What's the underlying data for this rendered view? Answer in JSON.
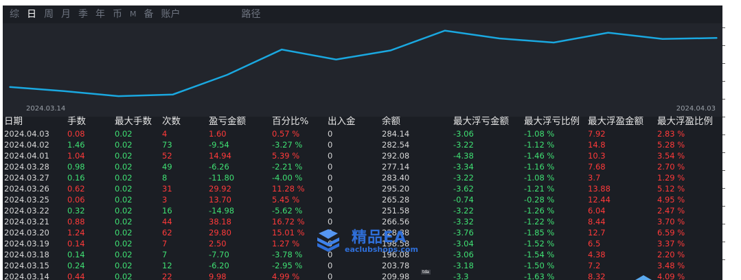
{
  "tabs": [
    {
      "label": "综",
      "active": false,
      "small": false
    },
    {
      "label": "日",
      "active": true,
      "small": false
    },
    {
      "label": "周",
      "active": false,
      "small": false
    },
    {
      "label": "月",
      "active": false,
      "small": false
    },
    {
      "label": "季",
      "active": false,
      "small": false
    },
    {
      "label": "年",
      "active": false,
      "small": false
    },
    {
      "label": "币",
      "active": false,
      "small": false
    },
    {
      "label": "M",
      "active": false,
      "small": true
    },
    {
      "label": "备",
      "active": false,
      "small": false
    },
    {
      "label": "账户",
      "active": false,
      "small": false
    }
  ],
  "path_tab": "路径",
  "chart_data": {
    "type": "line",
    "x_start_label": "2024.03.14",
    "x_end_label": "2024.04.03",
    "line_color": "#1aa8e0",
    "x": [
      "2024.03.14",
      "2024.03.15",
      "2024.03.18",
      "2024.03.19",
      "2024.03.20",
      "2024.03.21",
      "2024.03.22",
      "2024.03.25",
      "2024.03.26",
      "2024.03.27",
      "2024.03.28",
      "2024.04.01",
      "2024.04.02",
      "2024.04.03"
    ],
    "values": [
      209.98,
      203.78,
      196.08,
      198.58,
      228.38,
      266.56,
      251.58,
      265.28,
      295.2,
      283.4,
      277.14,
      292.08,
      282.54,
      284.14
    ],
    "ylim": [
      190,
      300
    ]
  },
  "table": {
    "headers": [
      "日期",
      "手数",
      "最大手数",
      "次数",
      "盈亏金额",
      "百分比%",
      "出入金",
      "余额",
      "最大浮亏金额",
      "最大浮亏比例",
      "最大浮盈金额",
      "最大浮盈比例"
    ],
    "colors": {
      "profit": "#ff3a3a",
      "loss": "#3fe073",
      "neutral": "#d7d7d7"
    },
    "rows": [
      {
        "date": "2024.04.03",
        "lots": "0.08",
        "max_lots": "0.02",
        "count": "4",
        "pnl": "1.60",
        "pct": "0.57 %",
        "io": "0",
        "balance": "284.14",
        "max_loss": "-3.06",
        "max_loss_pct": "-1.08 %",
        "max_profit": "7.92",
        "max_profit_pct": "2.83 %",
        "sign": "profit"
      },
      {
        "date": "2024.04.02",
        "lots": "1.46",
        "max_lots": "0.02",
        "count": "73",
        "pnl": "-9.54",
        "pct": "-3.27 %",
        "io": "0",
        "balance": "282.54",
        "max_loss": "-3.22",
        "max_loss_pct": "-1.12 %",
        "max_profit": "14.8",
        "max_profit_pct": "5.28 %",
        "sign": "loss"
      },
      {
        "date": "2024.04.01",
        "lots": "1.04",
        "max_lots": "0.02",
        "count": "52",
        "pnl": "14.94",
        "pct": "5.39 %",
        "io": "0",
        "balance": "292.08",
        "max_loss": "-4.38",
        "max_loss_pct": "-1.46 %",
        "max_profit": "10.3",
        "max_profit_pct": "3.54 %",
        "sign": "profit"
      },
      {
        "date": "2024.03.28",
        "lots": "0.98",
        "max_lots": "0.02",
        "count": "49",
        "pnl": "-6.26",
        "pct": "-2.21 %",
        "io": "0",
        "balance": "277.14",
        "max_loss": "-3.34",
        "max_loss_pct": "-1.16 %",
        "max_profit": "7.68",
        "max_profit_pct": "2.70 %",
        "sign": "loss"
      },
      {
        "date": "2024.03.27",
        "lots": "0.16",
        "max_lots": "0.02",
        "count": "8",
        "pnl": "-11.80",
        "pct": "-4.00 %",
        "io": "0",
        "balance": "283.40",
        "max_loss": "-3.22",
        "max_loss_pct": "-1.08 %",
        "max_profit": "3.7",
        "max_profit_pct": "1.29 %",
        "sign": "loss"
      },
      {
        "date": "2024.03.26",
        "lots": "0.62",
        "max_lots": "0.02",
        "count": "31",
        "pnl": "29.92",
        "pct": "11.28 %",
        "io": "0",
        "balance": "295.20",
        "max_loss": "-3.62",
        "max_loss_pct": "-1.21 %",
        "max_profit": "13.88",
        "max_profit_pct": "5.12 %",
        "sign": "profit"
      },
      {
        "date": "2024.03.25",
        "lots": "0.06",
        "max_lots": "0.02",
        "count": "3",
        "pnl": "13.70",
        "pct": "5.45 %",
        "io": "0",
        "balance": "265.28",
        "max_loss": "-0.74",
        "max_loss_pct": "-0.28 %",
        "max_profit": "12.44",
        "max_profit_pct": "4.95 %",
        "sign": "profit"
      },
      {
        "date": "2024.03.22",
        "lots": "0.32",
        "max_lots": "0.02",
        "count": "16",
        "pnl": "-14.98",
        "pct": "-5.62 %",
        "io": "0",
        "balance": "251.58",
        "max_loss": "-3.22",
        "max_loss_pct": "-1.26 %",
        "max_profit": "6.04",
        "max_profit_pct": "2.47 %",
        "sign": "loss"
      },
      {
        "date": "2024.03.21",
        "lots": "0.88",
        "max_lots": "0.02",
        "count": "44",
        "pnl": "38.18",
        "pct": "16.72 %",
        "io": "0",
        "balance": "266.56",
        "max_loss": "-3.32",
        "max_loss_pct": "-1.22 %",
        "max_profit": "8.44",
        "max_profit_pct": "3.70 %",
        "sign": "profit"
      },
      {
        "date": "2024.03.20",
        "lots": "1.24",
        "max_lots": "0.02",
        "count": "62",
        "pnl": "29.80",
        "pct": "15.01 %",
        "io": "0",
        "balance": "228.38",
        "max_loss": "-3.76",
        "max_loss_pct": "-1.85 %",
        "max_profit": "12.7",
        "max_profit_pct": "6.59 %",
        "sign": "profit"
      },
      {
        "date": "2024.03.19",
        "lots": "0.14",
        "max_lots": "0.02",
        "count": "7",
        "pnl": "2.50",
        "pct": "1.27 %",
        "io": "0",
        "balance": "198.58",
        "max_loss": "-3.04",
        "max_loss_pct": "-1.52 %",
        "max_profit": "6.5",
        "max_profit_pct": "3.37 %",
        "sign": "profit"
      },
      {
        "date": "2024.03.18",
        "lots": "0.14",
        "max_lots": "0.02",
        "count": "7",
        "pnl": "-7.70",
        "pct": "-3.78 %",
        "io": "0",
        "balance": "196.08",
        "max_loss": "-3.06",
        "max_loss_pct": "-1.54 %",
        "max_profit": "4.38",
        "max_profit_pct": "2.20 %",
        "sign": "loss"
      },
      {
        "date": "2024.03.15",
        "lots": "0.24",
        "max_lots": "0.02",
        "count": "12",
        "pnl": "-6.20",
        "pct": "-2.95 %",
        "io": "0",
        "balance": "203.78",
        "max_loss": "-3.18",
        "max_loss_pct": "-1.50 %",
        "max_profit": "7.2",
        "max_profit_pct": "3.48 %",
        "sign": "loss"
      },
      {
        "date": "2024.03.14",
        "lots": "0.44",
        "max_lots": "0.02",
        "count": "22",
        "pnl": "9.98",
        "pct": "4.99 %",
        "io": "0",
        "balance": "209.98",
        "max_loss": "-3.3",
        "max_loss_pct": "-1.63 %",
        "max_profit": "8.32",
        "max_profit_pct": "4.09 %",
        "sign": "profit"
      }
    ]
  },
  "watermark": {
    "title": "精品EA",
    "url": "eaclubshops.com",
    "logo_icon": "stacked-layers-icon"
  },
  "badge_text": "tda"
}
